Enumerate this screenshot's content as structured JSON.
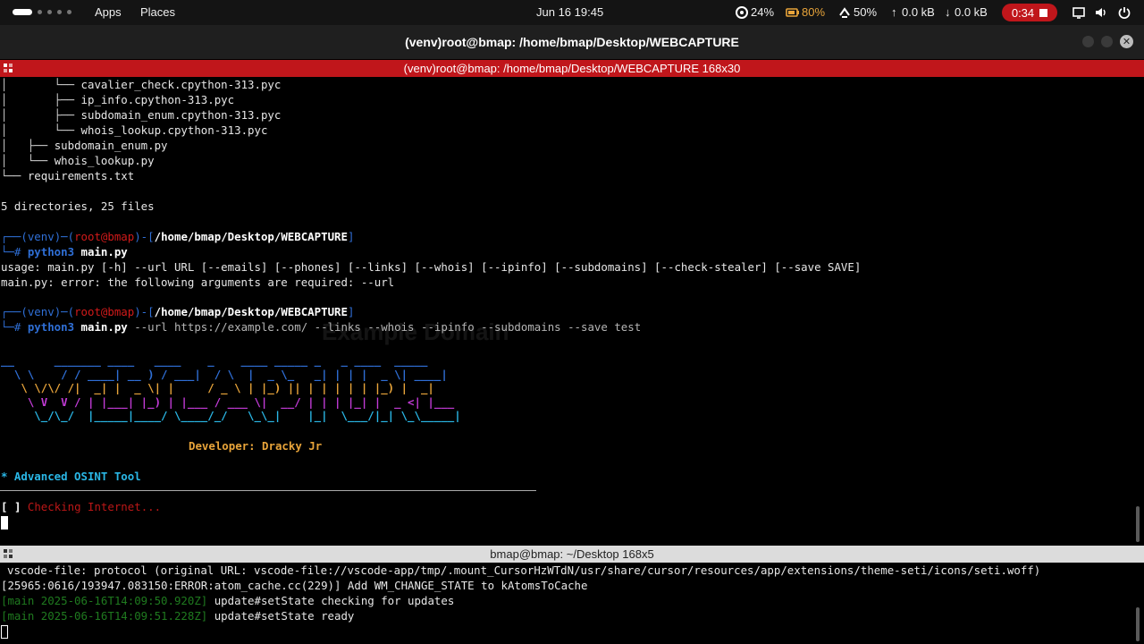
{
  "topbar": {
    "apps_label": "Apps",
    "places_label": "Places",
    "clock": "Jun 16  19:45",
    "cpu": "24%",
    "battery": "80%",
    "brightness": "50%",
    "upload": "0.0 kB",
    "download": "0.0 kB",
    "recording_time": "0:34",
    "battery_color": "#e8a43a"
  },
  "window": {
    "title": "(venv)root@bmap: /home/bmap/Desktop/WEBCAPTURE"
  },
  "terminal1": {
    "title": "(venv)root@bmap: /home/bmap/Desktop/WEBCAPTURE 168x30",
    "tree_lines": [
      "cavalier_check.cpython-313.pyc",
      "ip_info.cpython-313.pyc",
      "subdomain_enum.cpython-313.pyc",
      "whois_lookup.cpython-313.pyc",
      "subdomain_enum.py",
      "whois_lookup.py",
      "requirements.txt"
    ],
    "summary": "5 directories, 25 files",
    "prompt1": {
      "venv": "(venv)",
      "user": "root@bmap",
      "path": "/home/bmap/Desktop/WEBCAPTURE",
      "cmd_python": "python3",
      "cmd_file": "main.py",
      "cmd_args": ""
    },
    "usage_line": "usage: main.py [-h] --url URL [--emails] [--phones] [--links] [--whois] [--ipinfo] [--subdomains] [--check-stealer] [--save SAVE]",
    "error_line": "main.py: error: the following arguments are required: --url",
    "prompt2": {
      "venv": "(venv)",
      "user": "root@bmap",
      "path": "/home/bmap/Desktop/WEBCAPTURE",
      "cmd_python": "python3",
      "cmd_file": "main.py",
      "cmd_args": " --url https://example.com/ --links --whois --ipinfo --subdomains --save test"
    },
    "developer": "Developer: Dracky Jr",
    "tool_line": "* Advanced OSINT Tool",
    "status_bracket_open": "[",
    "status_bracket_mark": " ",
    "status_bracket_close": "]",
    "status_text": "Checking Internet..."
  },
  "terminal2": {
    "title": "bmap@bmap: ~/Desktop 168x5",
    "lines": [
      {
        "prefix": "",
        "text": "vscode-file: protocol (original URL: vscode-file://vscode-app/tmp/.mount_CursorHzWTdN/usr/share/cursor/resources/app/extensions/theme-seti/icons/seti.woff)"
      },
      {
        "prefix": "",
        "text": "[25965:0616/193947.083150:ERROR:atom_cache.cc(229)] Add WM_CHANGE_STATE to kAtomsToCache"
      },
      {
        "prefix": "[main 2025-06-16T14:09:50.920Z]",
        "text": " update#setState checking for updates"
      },
      {
        "prefix": "[main 2025-06-16T14:09:51.228Z]",
        "text": " update#setState ready"
      }
    ]
  },
  "ghost": {
    "heading": "Example Domain"
  }
}
